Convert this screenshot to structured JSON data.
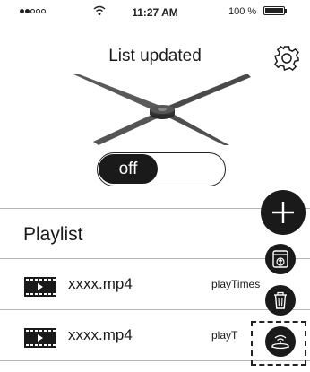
{
  "status_bar": {
    "time": "11:27 AM",
    "battery": "100 %",
    "battery_level": 1.0,
    "signal_bars": 2,
    "signal_total": 5
  },
  "header": {
    "title": "List updated",
    "settings_icon": "gear-icon"
  },
  "device": {
    "icon": "hologram-fan-icon"
  },
  "power_toggle": {
    "label": "off",
    "state": "off"
  },
  "playlist": {
    "title": "Playlist",
    "items": [
      {
        "name": "xxxx.mp4",
        "play_label": "playTimes",
        "icon": "video-file-icon"
      },
      {
        "name": "xxxx.mp4",
        "play_label": "playT",
        "icon": "video-file-icon"
      }
    ]
  },
  "floating_actions": [
    {
      "name": "add",
      "icon": "plus-icon"
    },
    {
      "name": "upload",
      "icon": "upload-icon"
    },
    {
      "name": "delete",
      "icon": "trash-icon"
    },
    {
      "name": "wifi-device",
      "icon": "wifi-device-icon"
    }
  ],
  "colors": {
    "foreground": "#1a1a1a",
    "background": "#ffffff",
    "divider": "#b5b5b5"
  }
}
